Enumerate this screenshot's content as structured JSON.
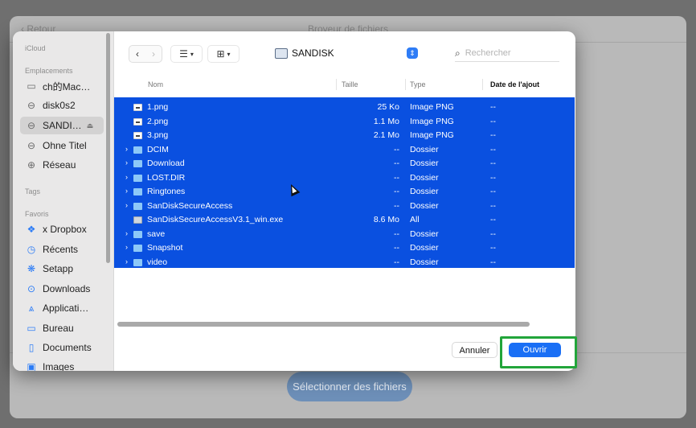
{
  "background": {
    "back_label": "‹ Retour",
    "title": "Broyeur de fichiers",
    "select_button": "Sélectionner des fichiers"
  },
  "sidebar": {
    "sections": [
      {
        "heading": "iCloud"
      },
      {
        "heading": "Emplacements"
      },
      {
        "heading": "Tags"
      },
      {
        "heading": "Favoris"
      }
    ],
    "locations": [
      {
        "label": "ch的Mac…",
        "icon": "laptop-icon"
      },
      {
        "label": "disk0s2",
        "icon": "drive-icon"
      },
      {
        "label": "SANDI…",
        "icon": "drive-icon",
        "selected": true,
        "eject": "⏏"
      },
      {
        "label": "Ohne Titel",
        "icon": "drive-icon"
      },
      {
        "label": "Réseau",
        "icon": "globe-icon"
      }
    ],
    "favorites": [
      {
        "label": "x Dropbox",
        "icon": "dropbox-icon"
      },
      {
        "label": "Récents",
        "icon": "clock-icon"
      },
      {
        "label": "Setapp",
        "icon": "setapp-icon"
      },
      {
        "label": "Downloads",
        "icon": "download-icon"
      },
      {
        "label": "Applicati…",
        "icon": "apps-icon"
      },
      {
        "label": "Bureau",
        "icon": "desktop-icon"
      },
      {
        "label": "Documents",
        "icon": "document-icon"
      },
      {
        "label": "Images",
        "icon": "image-icon"
      }
    ]
  },
  "toolbar": {
    "location_label": "SANDISK",
    "search_placeholder": "Rechercher"
  },
  "columns": {
    "name": "Nom",
    "size": "Taille",
    "type": "Type",
    "date": "Date de l'ajout"
  },
  "files": [
    {
      "name": "1.png",
      "size": "25 Ko",
      "type": "Image PNG",
      "date": "--",
      "kind": "image"
    },
    {
      "name": "2.png",
      "size": "1.1 Mo",
      "type": "Image PNG",
      "date": "--",
      "kind": "image"
    },
    {
      "name": "3.png",
      "size": "2.1 Mo",
      "type": "Image PNG",
      "date": "--",
      "kind": "image"
    },
    {
      "name": "DCIM",
      "size": "--",
      "type": "Dossier",
      "date": "--",
      "kind": "folder"
    },
    {
      "name": "Download",
      "size": "--",
      "type": "Dossier",
      "date": "--",
      "kind": "folder"
    },
    {
      "name": "LOST.DIR",
      "size": "--",
      "type": "Dossier",
      "date": "--",
      "kind": "folder"
    },
    {
      "name": "Ringtones",
      "size": "--",
      "type": "Dossier",
      "date": "--",
      "kind": "folder"
    },
    {
      "name": "SanDiskSecureAccess",
      "size": "--",
      "type": "Dossier",
      "date": "--",
      "kind": "folder"
    },
    {
      "name": "SanDiskSecureAccessV3.1_win.exe",
      "size": "8.6 Mo",
      "type": "All",
      "date": "--",
      "kind": "exe"
    },
    {
      "name": "save",
      "size": "--",
      "type": "Dossier",
      "date": "--",
      "kind": "folder"
    },
    {
      "name": "Snapshot",
      "size": "--",
      "type": "Dossier",
      "date": "--",
      "kind": "folder"
    },
    {
      "name": "video",
      "size": "--",
      "type": "Dossier",
      "date": "--",
      "kind": "folder"
    }
  ],
  "footer": {
    "cancel_label": "Annuler",
    "open_label": "Ouvrir"
  },
  "colors": {
    "selection": "#0a50e0",
    "accent": "#1a6ff5",
    "highlight": "#22a53a"
  }
}
